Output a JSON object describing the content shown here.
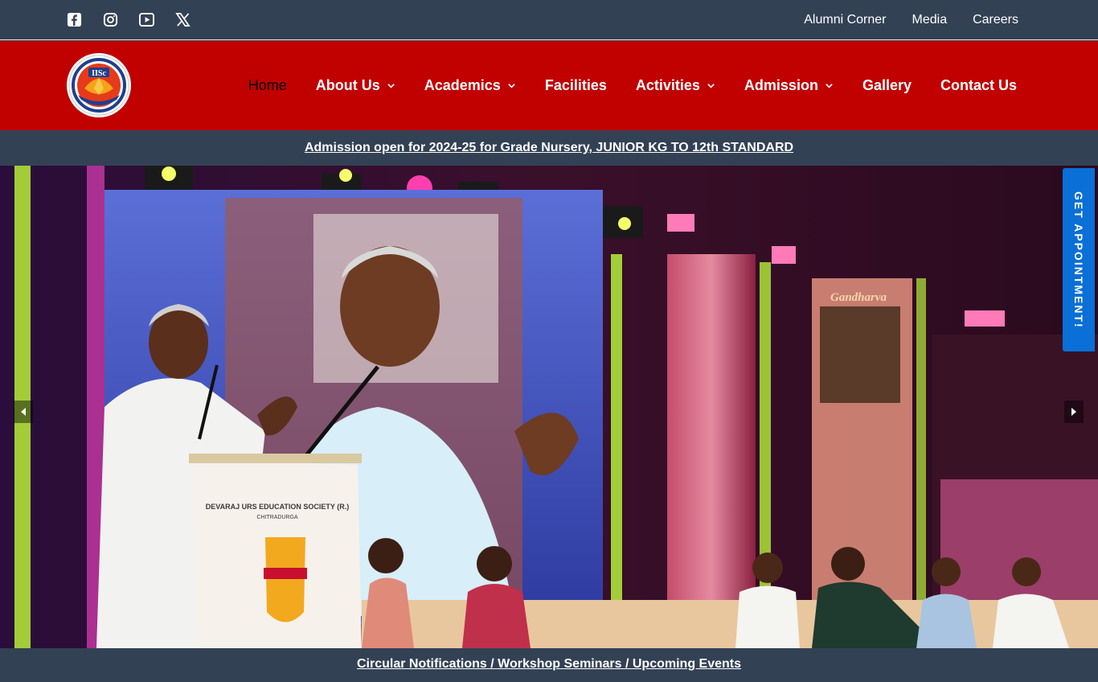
{
  "topbar": {
    "social": [
      {
        "icon": "facebook-icon"
      },
      {
        "icon": "instagram-icon"
      },
      {
        "icon": "youtube-icon"
      },
      {
        "icon": "x-twitter-icon"
      }
    ],
    "links": [
      {
        "label": "Alumni Corner"
      },
      {
        "label": "Media"
      },
      {
        "label": "Careers"
      }
    ]
  },
  "header": {
    "logo": {
      "text": "IISc"
    },
    "nav": [
      {
        "label": "Home",
        "active": true,
        "dropdown": false
      },
      {
        "label": "About Us",
        "dropdown": true
      },
      {
        "label": "Academics",
        "dropdown": true
      },
      {
        "label": "Facilities",
        "dropdown": false
      },
      {
        "label": "Activities",
        "dropdown": true
      },
      {
        "label": "Admission",
        "dropdown": true
      },
      {
        "label": "Gallery",
        "dropdown": false
      },
      {
        "label": "Contact Us",
        "dropdown": false
      }
    ]
  },
  "announcement": {
    "text": "Admission open for 2024-25 for Grade Nursery, JUNIOR KG TO 12th STANDARD"
  },
  "hero": {
    "podium_line1": "DEVARAJ URS EDUCATION SOCIETY (R.)",
    "podium_line2": "CHITRADURGA",
    "banner_text": "Gandharva"
  },
  "appointment": {
    "label": "GET APPOINTMENT!"
  },
  "footer_links": {
    "text": "Circular Notifications / Workshop Seminars / Upcoming Events"
  },
  "colors": {
    "topbar": "#334155",
    "header": "#c10000",
    "appointment": "#0a6fd6"
  }
}
